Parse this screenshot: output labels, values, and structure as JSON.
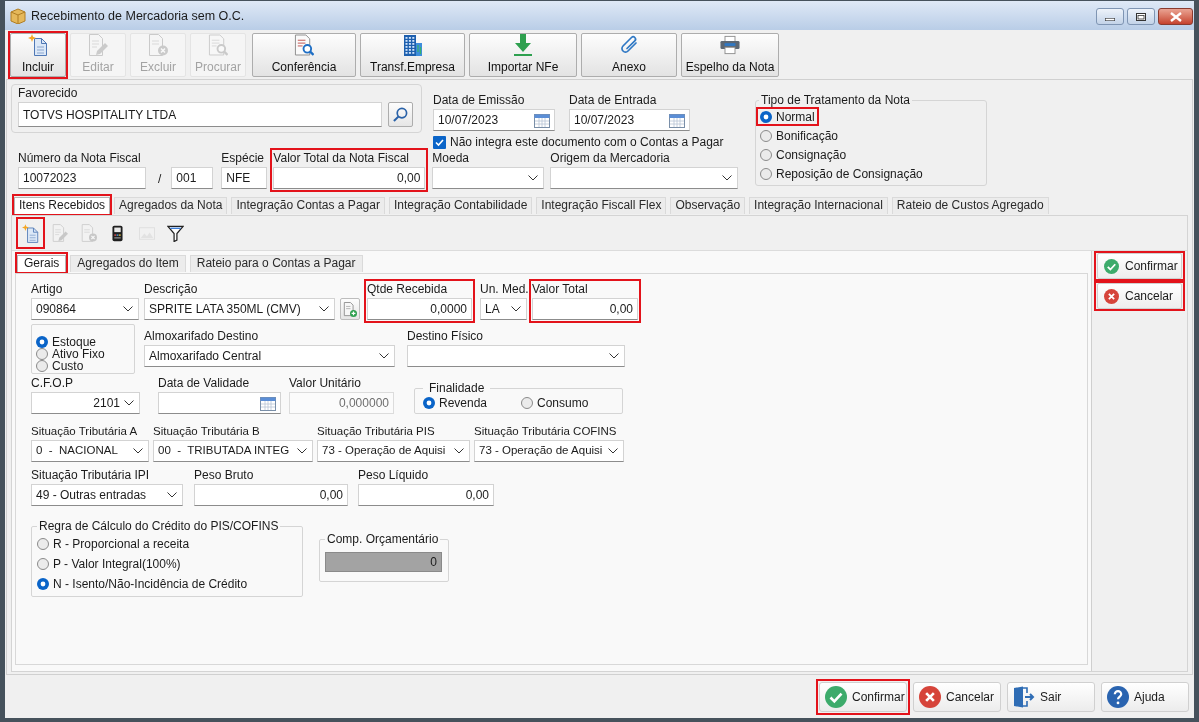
{
  "window": {
    "title": "Recebimento de Mercadoria sem O.C."
  },
  "toolbar": [
    {
      "label": "Incluir",
      "disabled": false,
      "highlighted": true
    },
    {
      "label": "Editar",
      "disabled": true,
      "highlighted": false
    },
    {
      "label": "Excluir",
      "disabled": true,
      "highlighted": false
    },
    {
      "label": "Procurar",
      "disabled": true,
      "highlighted": false
    },
    {
      "label": "Conferência",
      "disabled": false,
      "highlighted": false
    },
    {
      "label": "Transf.Empresa",
      "disabled": false,
      "highlighted": false
    },
    {
      "label": "Importar NFe",
      "disabled": false,
      "highlighted": false
    },
    {
      "label": "Anexo",
      "disabled": false,
      "highlighted": false
    },
    {
      "label": "Espelho da Nota",
      "disabled": false,
      "highlighted": false
    }
  ],
  "header": {
    "favorecido": {
      "label": "Favorecido",
      "value": "TOTVS HOSPITALITY LTDA"
    },
    "data_emissao": {
      "label": "Data de Emissão",
      "value": "10/07/2023"
    },
    "data_entrada": {
      "label": "Data de Entrada",
      "value": "10/07/2023"
    },
    "nao_integra": {
      "label": "Não integra este documento com o Contas a Pagar",
      "checked": true
    },
    "tipo_tratamento": {
      "label": "Tipo de Tratamento da Nota",
      "options": [
        {
          "label": "Normal",
          "selected": true,
          "highlighted": true
        },
        {
          "label": "Bonificação",
          "selected": false,
          "highlighted": false
        },
        {
          "label": "Consignação",
          "selected": false,
          "highlighted": false
        },
        {
          "label": "Reposição de Consignação",
          "selected": false,
          "highlighted": false
        }
      ]
    },
    "numero_nota": {
      "label": "Número da Nota Fiscal",
      "value": "10072023"
    },
    "serie_separator": "/",
    "serie": {
      "value": "001"
    },
    "especie": {
      "label": "Espécie",
      "value": "NFE"
    },
    "valor_total_nota": {
      "label": "Valor Total da Nota Fiscal",
      "value": "0,00",
      "highlighted": true
    },
    "moeda": {
      "label": "Moeda"
    },
    "origem": {
      "label": "Origem da Mercadoria"
    }
  },
  "tabs": [
    {
      "label": "Itens Recebidos",
      "selected": true,
      "highlighted": true
    },
    {
      "label": "Agregados da Nota",
      "selected": false,
      "highlighted": false
    },
    {
      "label": "Integração Contas a Pagar",
      "selected": false,
      "highlighted": false
    },
    {
      "label": "Integração Contabilidade",
      "selected": false,
      "highlighted": false
    },
    {
      "label": "Integração Fiscall Flex",
      "selected": false,
      "highlighted": false
    },
    {
      "label": "Observação",
      "selected": false,
      "highlighted": false
    },
    {
      "label": "Integração Internacional",
      "selected": false,
      "highlighted": false
    },
    {
      "label": "Rateio de Custos Agregado",
      "selected": false,
      "highlighted": false
    }
  ],
  "item_toolbar": [
    {
      "disabled": false,
      "highlighted": true
    },
    {
      "disabled": true,
      "highlighted": false
    },
    {
      "disabled": true,
      "highlighted": false
    },
    {
      "disabled": false,
      "highlighted": false
    },
    {
      "disabled": true,
      "highlighted": false
    },
    {
      "disabled": false,
      "highlighted": false
    }
  ],
  "item_tabs": [
    {
      "label": "Gerais",
      "selected": true,
      "highlighted": true
    },
    {
      "label": "Agregados do Item",
      "selected": false,
      "highlighted": false
    },
    {
      "label": "Rateio para o Contas a Pagar",
      "selected": false,
      "highlighted": false
    }
  ],
  "item": {
    "artigo": {
      "label": "Artigo",
      "value": "090864"
    },
    "descricao": {
      "label": "Descrição",
      "value": "SPRITE LATA 350ML (CMV)"
    },
    "qtde_recebida": {
      "label": "Qtde Recebida",
      "value": "0,0000",
      "highlighted": true
    },
    "un_med": {
      "label": "Un. Med.",
      "value": "LA"
    },
    "valor_total": {
      "label": "Valor Total",
      "value": "0,00",
      "highlighted": true
    },
    "tipo_artigo": [
      {
        "label": "Estoque",
        "selected": true
      },
      {
        "label": "Ativo Fixo",
        "selected": false
      },
      {
        "label": "Custo",
        "selected": false
      }
    ],
    "almoxarifado_destino": {
      "label": "Almoxarifado Destino",
      "value": "Almoxarifado Central"
    },
    "destino_fisico": {
      "label": "Destino Físico"
    },
    "cfop": {
      "label": "C.F.O.P",
      "value": "2101"
    },
    "data_validade": {
      "label": "Data de Validade"
    },
    "valor_unitario": {
      "label": "Valor Unitário",
      "value": "0,000000",
      "disabled": true
    },
    "finalidade": {
      "label": "Finalidade",
      "options": [
        {
          "label": "Revenda",
          "selected": true
        },
        {
          "label": "Consumo",
          "selected": false
        }
      ]
    },
    "sit_trib_a": {
      "label": "Situação Tributária A",
      "value": "0  -  NACIONAL"
    },
    "sit_trib_b": {
      "label": "Situação Tributária B",
      "value": "00  -  TRIBUTADA INTEG"
    },
    "sit_trib_pis": {
      "label": "Situação Tributária PIS",
      "value": "73 - Operação de Aquisi"
    },
    "sit_trib_cofins": {
      "label": "Situação Tributária COFINS",
      "value": "73 - Operação de Aquisi"
    },
    "sit_trib_ipi": {
      "label": "Situação Tributária IPI",
      "value": "49 - Outras entradas"
    },
    "peso_bruto": {
      "label": "Peso Bruto",
      "value": "0,00"
    },
    "peso_liquido": {
      "label": "Peso Líquido",
      "value": "0,00"
    },
    "regra_credito": {
      "label": "Regra de Cálculo do Crédito do PIS/COFINS",
      "options": [
        {
          "label": "R - Proporcional a receita",
          "selected": false
        },
        {
          "label": "P - Valor Integral(100%)",
          "selected": false
        },
        {
          "label": "N - Isento/Não-Incidência de Crédito",
          "selected": true
        }
      ]
    },
    "comp_orcamentario": {
      "label": "Comp. Orçamentário",
      "value": "0",
      "disabled": true
    }
  },
  "side_buttons": [
    {
      "label": "Confirmar",
      "highlighted": true
    },
    {
      "label": "Cancelar",
      "highlighted": true
    }
  ],
  "bottom_buttons": [
    {
      "label": "Confirmar",
      "highlighted": true
    },
    {
      "label": "Cancelar",
      "highlighted": false
    },
    {
      "label": "Sair",
      "highlighted": false
    },
    {
      "label": "Ajuda",
      "highlighted": false
    }
  ]
}
